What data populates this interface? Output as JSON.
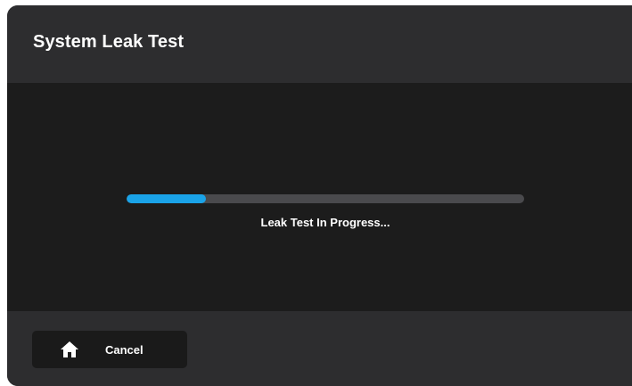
{
  "header": {
    "title": "System Leak Test"
  },
  "progress": {
    "fraction": 0.2,
    "status_text": "Leak Test In Progress...",
    "fill_color": "#1aa3e8",
    "track_color": "#4a4a4d"
  },
  "footer": {
    "cancel_label": "Cancel",
    "cancel_icon": "home-icon"
  }
}
